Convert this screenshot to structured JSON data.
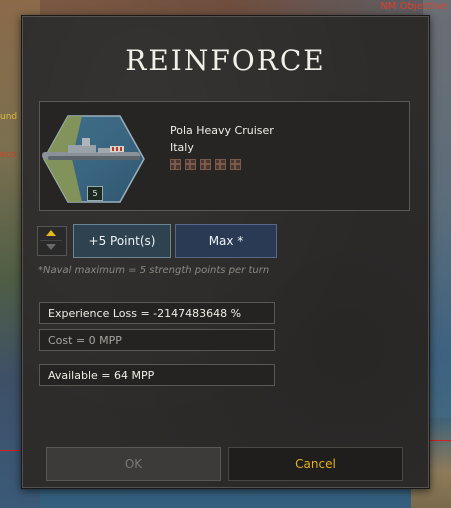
{
  "map": {
    "objective_label": "NM Objective",
    "frag_a": "und",
    "frag_b": "eco"
  },
  "dialog": {
    "title": "REINFORCE",
    "unit": {
      "name": "Pola Heavy Cruiser",
      "country": "Italy",
      "strength": "5",
      "experience_pips": 5,
      "icon": "heavy-cruiser-icon"
    },
    "stepper": {
      "up_icon": "arrow-up-icon",
      "down_icon": "arrow-down-icon"
    },
    "points_button": "+5 Point(s)",
    "max_button": "Max *",
    "note": "*Naval maximum = 5 strength points per turn",
    "experience_loss": "Experience Loss = -2147483648 %",
    "cost": "Cost = 0 MPP",
    "available": "Available = 64 MPP",
    "ok_button": "OK",
    "cancel_button": "Cancel"
  },
  "colors": {
    "accent_yellow": "#e3b01a",
    "dialog_bg": "#2e2c2b",
    "title": "#f2efe8"
  }
}
